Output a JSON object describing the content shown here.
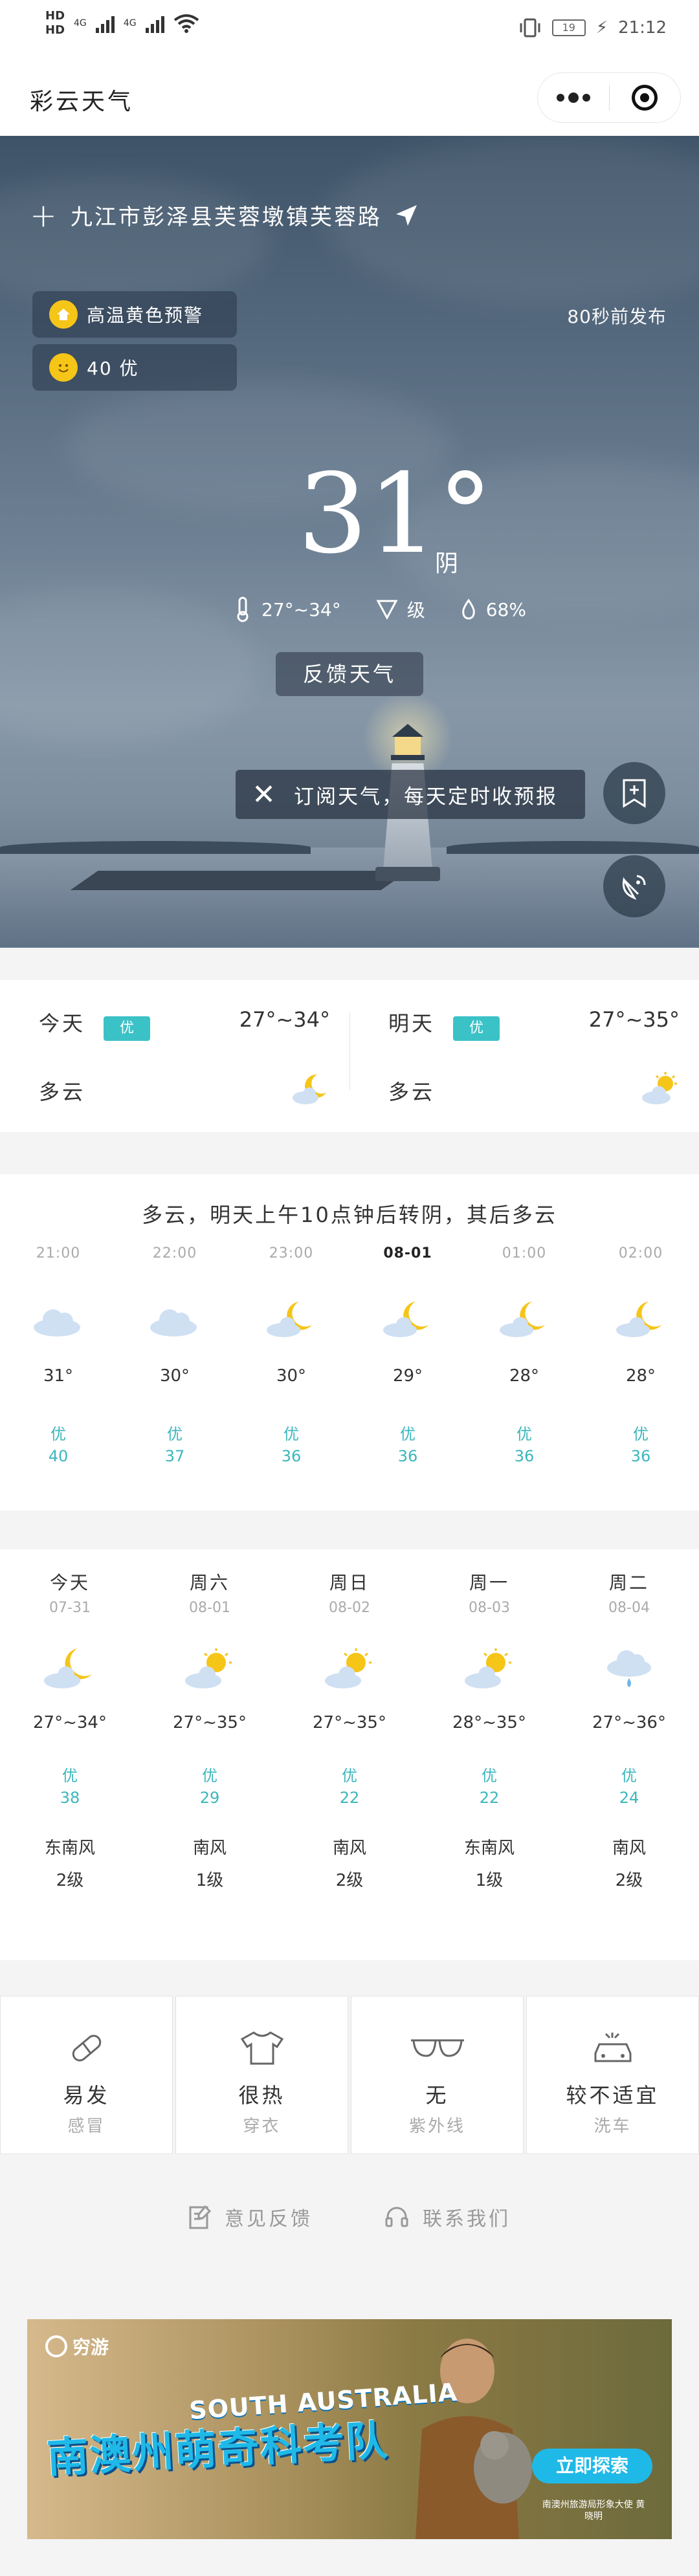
{
  "status_bar": {
    "hd1": "HD",
    "hd2": "HD",
    "net1": "4G",
    "net2": "4G",
    "battery": "19",
    "time": "21:12"
  },
  "header": {
    "title": "彩云天气"
  },
  "hero": {
    "location": "九江市彭泽县芙蓉墩镇芙蓉路",
    "alerts": [
      {
        "label": "高温黄色预警",
        "icon": "high-temp-icon"
      },
      {
        "label": "40 优",
        "icon": "smile-icon"
      }
    ],
    "published": "80秒前发布",
    "temperature": "31°",
    "condition": "阴",
    "temp_range": "27°~34°",
    "wind_level": "级",
    "humidity": "68%",
    "feedback_label": "反馈天气",
    "subscribe_text": "订阅天气，每天定时收预报"
  },
  "two_day": [
    {
      "day": "今天",
      "aqi": "优",
      "range": "27°~34°",
      "cond": "多云"
    },
    {
      "day": "明天",
      "aqi": "优",
      "range": "27°~35°",
      "cond": "多云"
    }
  ],
  "hourly": {
    "summary": "多云，明天上午10点钟后转阴，其后多云",
    "items": [
      {
        "time": "21:00",
        "temp": "31°",
        "aqi": "优",
        "aqi_val": "40",
        "icon": "cloud"
      },
      {
        "time": "22:00",
        "temp": "30°",
        "aqi": "优",
        "aqi_val": "37",
        "icon": "cloud"
      },
      {
        "time": "23:00",
        "temp": "30°",
        "aqi": "优",
        "aqi_val": "36",
        "icon": "moon-cloud"
      },
      {
        "time": "08-01",
        "temp": "29°",
        "aqi": "优",
        "aqi_val": "36",
        "icon": "moon-cloud"
      },
      {
        "time": "01:00",
        "temp": "28°",
        "aqi": "优",
        "aqi_val": "36",
        "icon": "moon-cloud"
      },
      {
        "time": "02:00",
        "temp": "28°",
        "aqi": "优",
        "aqi_val": "36",
        "icon": "moon-cloud"
      }
    ]
  },
  "daily": [
    {
      "day": "今天",
      "date": "07-31",
      "range": "27°~34°",
      "aqi": "优",
      "aqi_val": "38",
      "wind": "东南风",
      "level": "2级",
      "icon": "moon-cloud"
    },
    {
      "day": "周六",
      "date": "08-01",
      "range": "27°~35°",
      "aqi": "优",
      "aqi_val": "29",
      "wind": "南风",
      "level": "1级",
      "icon": "sun-cloud"
    },
    {
      "day": "周日",
      "date": "08-02",
      "range": "27°~35°",
      "aqi": "优",
      "aqi_val": "22",
      "wind": "南风",
      "level": "2级",
      "icon": "sun-cloud"
    },
    {
      "day": "周一",
      "date": "08-03",
      "range": "28°~35°",
      "aqi": "优",
      "aqi_val": "22",
      "wind": "东南风",
      "level": "1级",
      "icon": "sun-cloud"
    },
    {
      "day": "周二",
      "date": "08-04",
      "range": "27°~36°",
      "aqi": "优",
      "aqi_val": "24",
      "wind": "南风",
      "level": "2级",
      "icon": "rain-cloud"
    }
  ],
  "life": [
    {
      "value": "易发",
      "label": "感冒",
      "icon": "pill-icon"
    },
    {
      "value": "很热",
      "label": "穿衣",
      "icon": "shirt-icon"
    },
    {
      "value": "无",
      "label": "紫外线",
      "icon": "sunglasses-icon"
    },
    {
      "value": "较不适宜",
      "label": "洗车",
      "icon": "car-icon"
    }
  ],
  "links": {
    "feedback": "意见反馈",
    "contact": "联系我们"
  },
  "ad": {
    "brand": "穷游",
    "title_en": "SOUTH AUSTRALIA",
    "title_cn": "南澳州萌奇科考队",
    "cta": "立即探索",
    "small": "南澳州旅游局形象大使 黄晓明"
  },
  "colors": {
    "accent": "#3bc2c7",
    "aqi_text": "#3bb7bd",
    "sun": "#f5c518"
  }
}
